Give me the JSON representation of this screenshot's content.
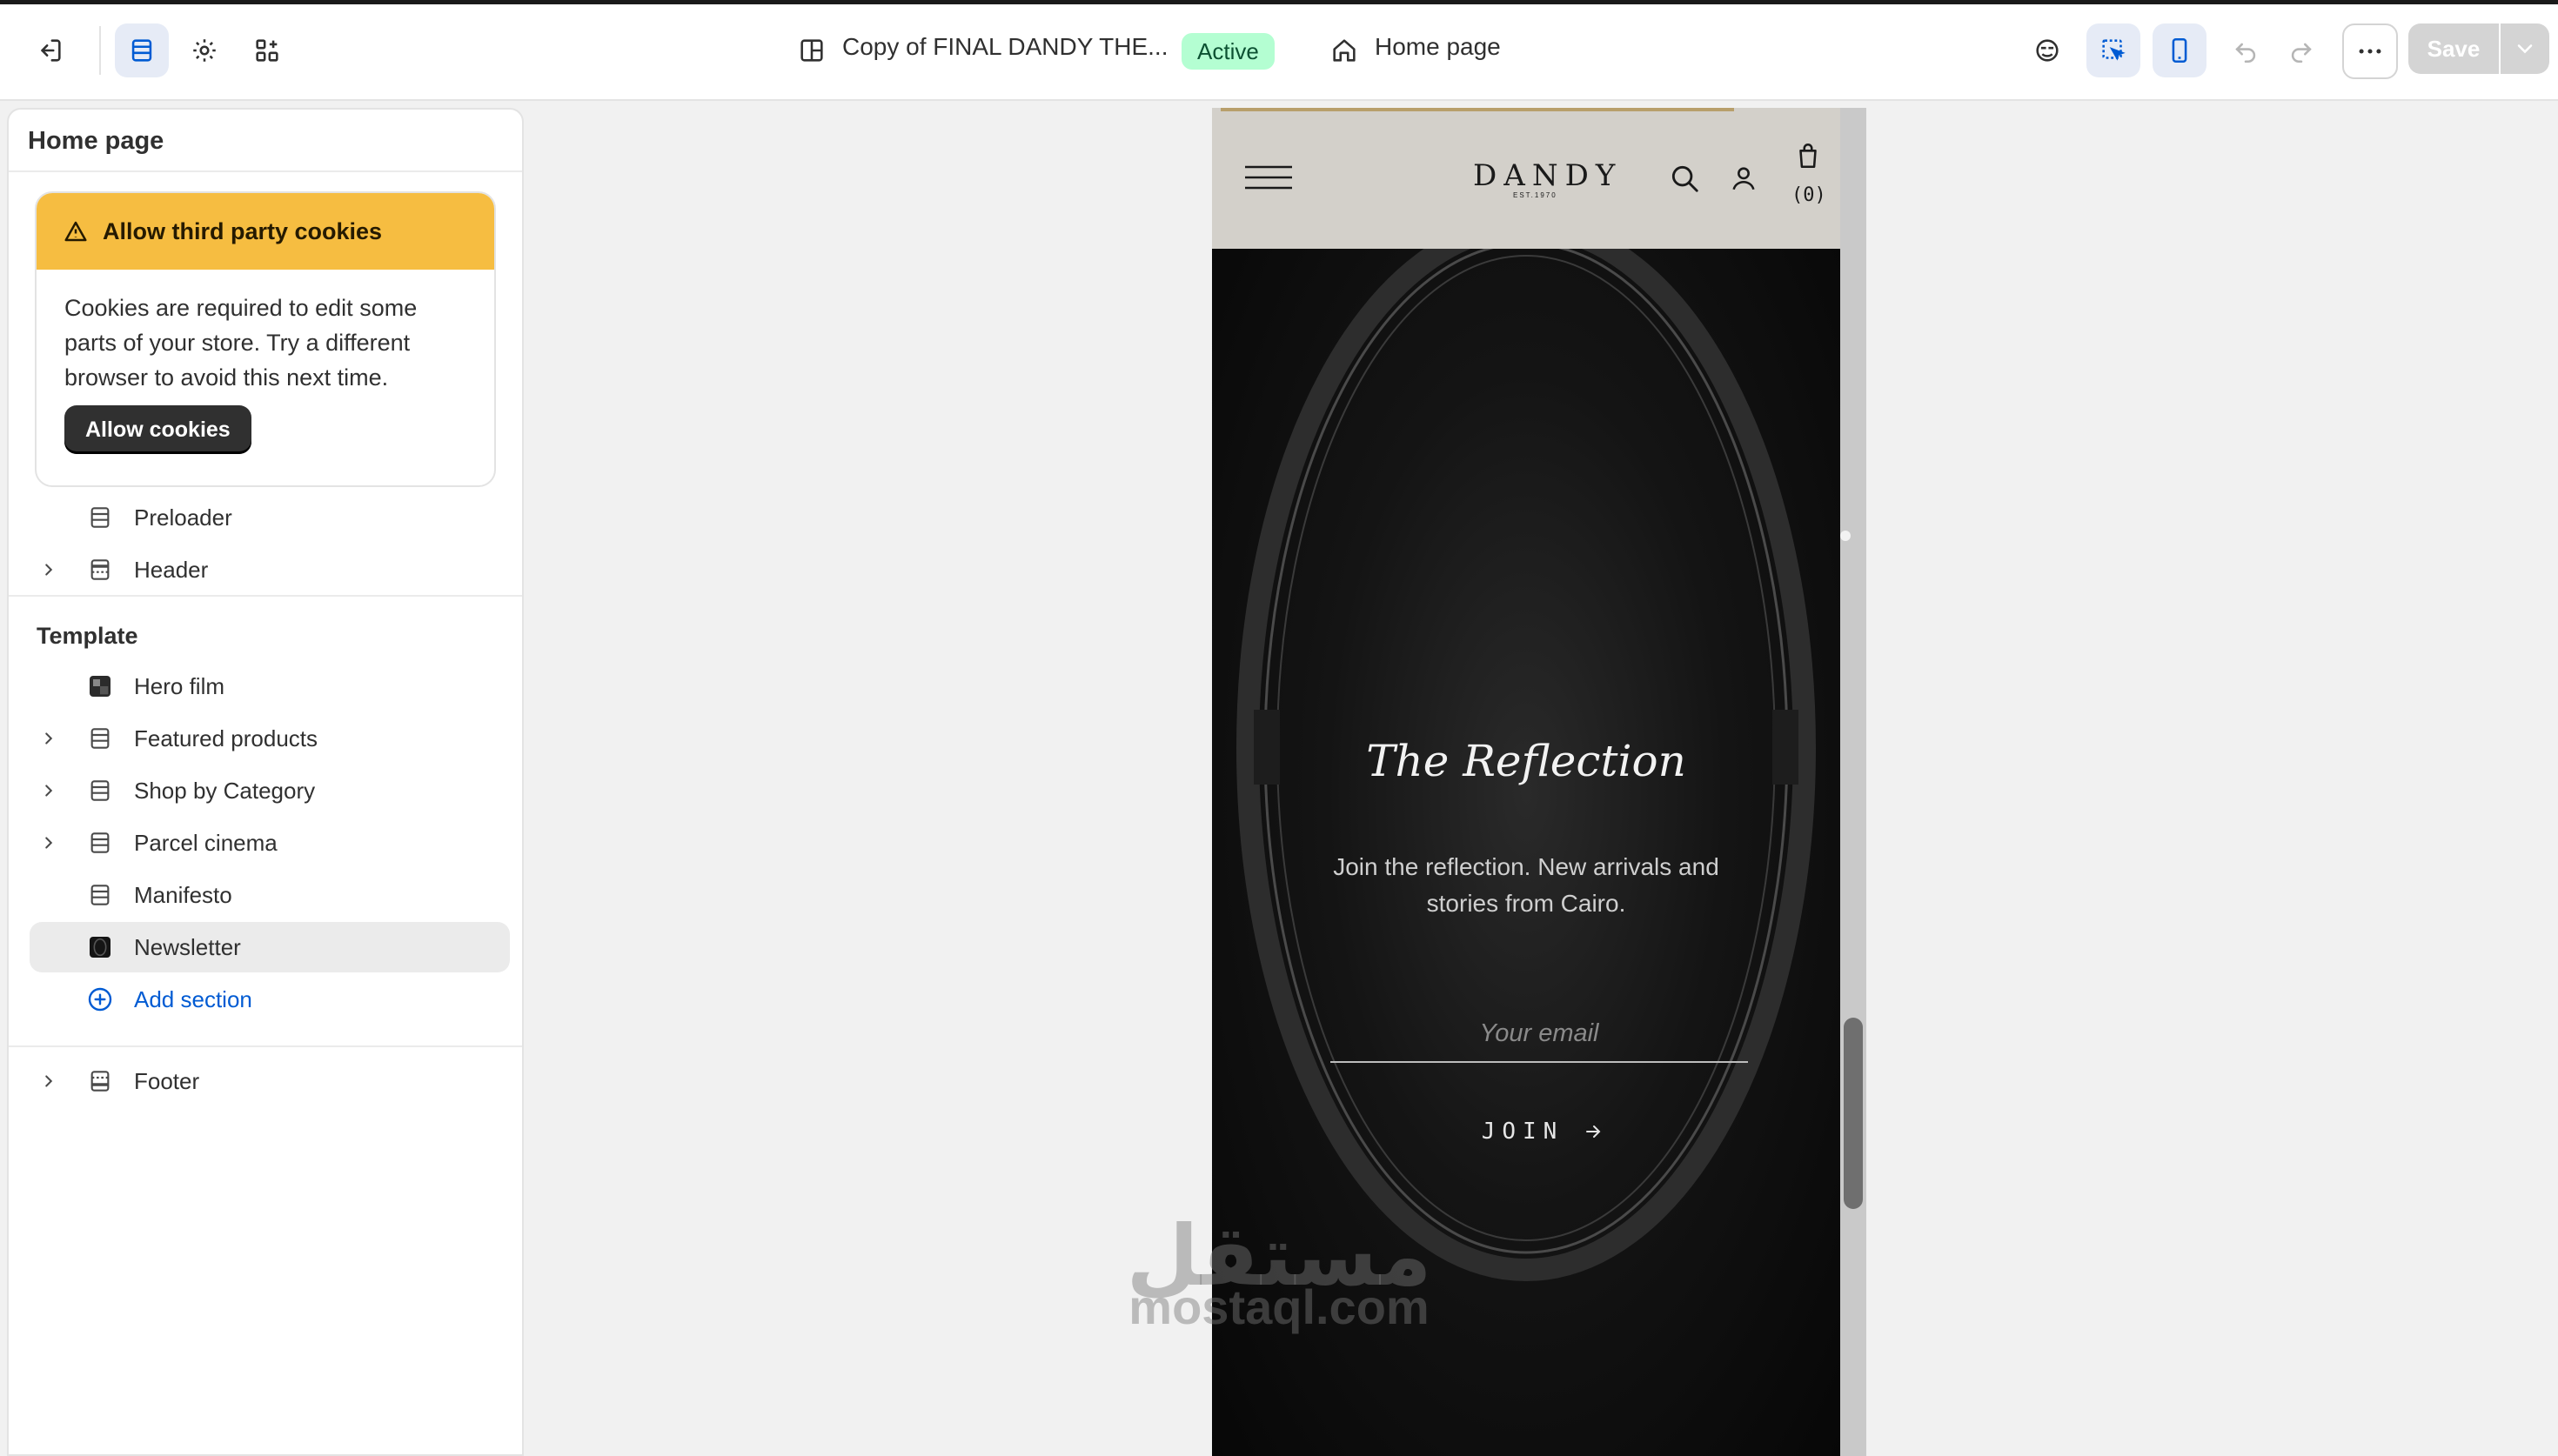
{
  "topbar": {
    "theme_name": "Copy of FINAL DANDY THE...",
    "status_badge": "Active",
    "page_name": "Home page",
    "save_label": "Save"
  },
  "sidebar": {
    "title": "Home page",
    "cookie_notice": {
      "title": "Allow third party cookies",
      "body": "Cookies are required to edit some parts of your store. Try a different browser to avoid this next time.",
      "button": "Allow cookies"
    },
    "header_group": [
      {
        "label": "Preloader",
        "icon": "section-icon",
        "expandable": false
      },
      {
        "label": "Header",
        "icon": "header-section-icon",
        "expandable": true
      }
    ],
    "template_title": "Template",
    "template_items": [
      {
        "label": "Hero film",
        "icon": "video-thumbnail-icon",
        "expandable": false
      },
      {
        "label": "Featured products",
        "icon": "section-icon",
        "expandable": true
      },
      {
        "label": "Shop by Category",
        "icon": "section-icon",
        "expandable": true
      },
      {
        "label": "Parcel cinema",
        "icon": "section-icon",
        "expandable": true
      },
      {
        "label": "Manifesto",
        "icon": "section-icon",
        "expandable": false
      },
      {
        "label": "Newsletter",
        "icon": "image-thumbnail-icon",
        "expandable": false,
        "selected": true
      }
    ],
    "add_section": "Add section",
    "footer_items": [
      {
        "label": "Footer",
        "icon": "footer-section-icon",
        "expandable": true
      }
    ]
  },
  "preview": {
    "logo": "DANDY",
    "logo_sub": "EST.1970",
    "cart_count": "(0)",
    "newsletter": {
      "title": "The Reflection",
      "text": "Join the reflection. New arrivals and stories from Cairo.",
      "email_placeholder": "Your email",
      "join_label": "JOIN"
    }
  },
  "watermark": {
    "arabic": "مستقل",
    "latin": "mostaql.com"
  },
  "colors": {
    "accent_blue": "#005bd3",
    "warning": "#f6bd41",
    "success_bg": "#b4fed2",
    "success_text": "#0c5132"
  }
}
